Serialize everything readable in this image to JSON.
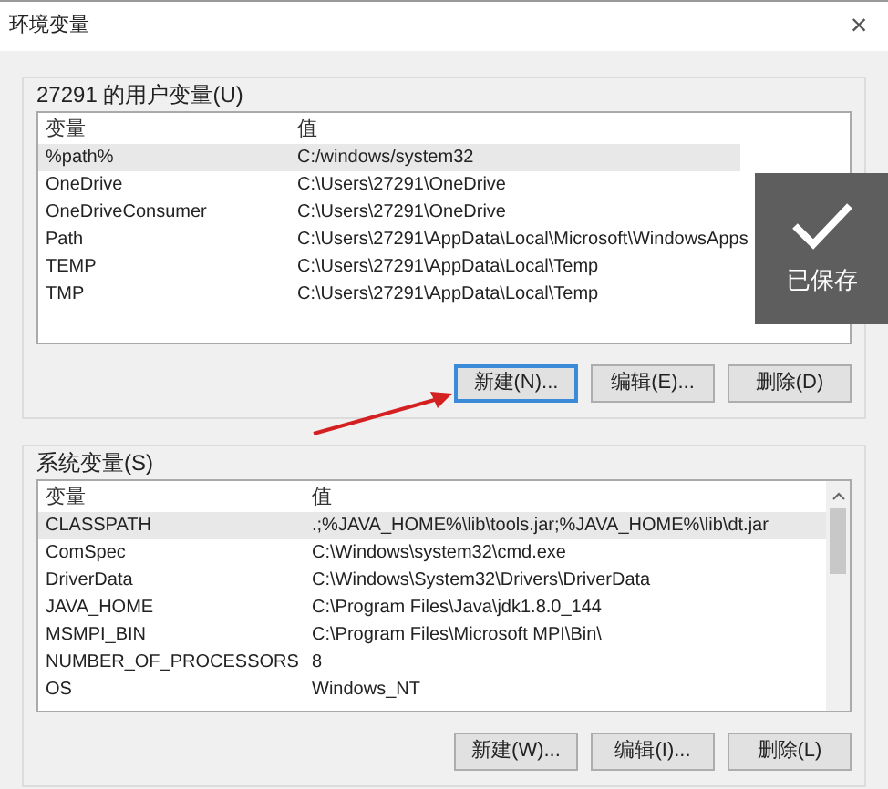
{
  "window": {
    "title": "环境变量",
    "close": "×"
  },
  "user_vars": {
    "label": "27291 的用户变量(U)",
    "columns": [
      "变量",
      "值"
    ],
    "rows": [
      {
        "name": "%path%",
        "value": "C:/windows/system32",
        "selected": true
      },
      {
        "name": "OneDrive",
        "value": "C:\\Users\\27291\\OneDrive",
        "selected": false
      },
      {
        "name": "OneDriveConsumer",
        "value": "C:\\Users\\27291\\OneDrive",
        "selected": false
      },
      {
        "name": "Path",
        "value": "C:\\Users\\27291\\AppData\\Local\\Microsoft\\WindowsApps",
        "selected": false
      },
      {
        "name": "TEMP",
        "value": "C:\\Users\\27291\\AppData\\Local\\Temp",
        "selected": false
      },
      {
        "name": "TMP",
        "value": "C:\\Users\\27291\\AppData\\Local\\Temp",
        "selected": false
      }
    ],
    "buttons": [
      {
        "label": "新建(N)...",
        "focused": true
      },
      {
        "label": "编辑(E)...",
        "focused": false
      },
      {
        "label": "删除(D)",
        "focused": false
      }
    ]
  },
  "system_vars": {
    "label": "系统变量(S)",
    "columns": [
      "变量",
      "值"
    ],
    "rows": [
      {
        "name": "CLASSPATH",
        "value": ".;%JAVA_HOME%\\lib\\tools.jar;%JAVA_HOME%\\lib\\dt.jar",
        "selected": true
      },
      {
        "name": "ComSpec",
        "value": "C:\\Windows\\system32\\cmd.exe",
        "selected": false
      },
      {
        "name": "DriverData",
        "value": "C:\\Windows\\System32\\Drivers\\DriverData",
        "selected": false
      },
      {
        "name": "JAVA_HOME",
        "value": "C:\\Program Files\\Java\\jdk1.8.0_144",
        "selected": false
      },
      {
        "name": "MSMPI_BIN",
        "value": "C:\\Program Files\\Microsoft MPI\\Bin\\",
        "selected": false
      },
      {
        "name": "NUMBER_OF_PROCESSORS",
        "value": "8",
        "selected": false
      },
      {
        "name": "OS",
        "value": "Windows_NT",
        "selected": false
      }
    ],
    "buttons": [
      {
        "label": "新建(W)...",
        "focused": false
      },
      {
        "label": "编辑(I)...",
        "focused": false
      },
      {
        "label": "删除(L)",
        "focused": false
      }
    ]
  },
  "toast": {
    "text": "已保存"
  }
}
